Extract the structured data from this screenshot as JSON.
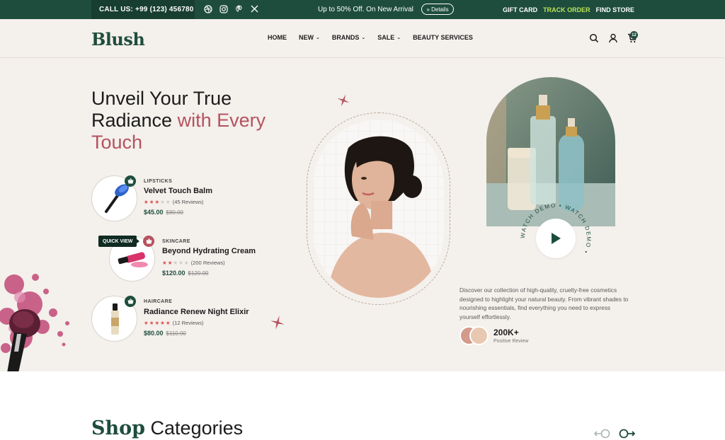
{
  "topbar": {
    "call": "CALL US: +99 (123) 456780",
    "social_icons": [
      "dribbble-icon",
      "instagram-icon",
      "pinterest-icon",
      "x-icon"
    ],
    "promo": "Up to 50% Off. On New Arrival",
    "details_label": "» Details",
    "links": [
      "GIFT CARD",
      "TRACK ORDER",
      "FIND STORE"
    ],
    "highlight_color": "#b9e35a"
  },
  "header": {
    "logo": "Blush",
    "nav": [
      {
        "label": "HOME"
      },
      {
        "label": "NEW"
      },
      {
        "label": "BRANDS"
      },
      {
        "label": "SALE"
      },
      {
        "label": "BEAUTY SERVICES"
      }
    ],
    "cart_count": "12",
    "icons": [
      "search-icon",
      "user-icon",
      "cart-icon"
    ]
  },
  "hero": {
    "headline_1": "Unveil Your True",
    "headline_2a": "Radiance ",
    "headline_2b": "with Every",
    "headline_3": "Touch",
    "quick_view": "QUICK VIEW",
    "products": [
      {
        "category": "LIPSTICKS",
        "name": "Velvet Touch Balm",
        "rating": 3,
        "reviews": "(45 Reviews)",
        "price": "$45.00",
        "old_price": "$80.00"
      },
      {
        "category": "SKINCARE",
        "name": "Beyond Hydrating Cream",
        "rating": 2,
        "reviews": "(200 Reviews)",
        "price": "$120.00",
        "old_price": "$120.00"
      },
      {
        "category": "HAIRCARE",
        "name": "Radiance Renew Night Elixir",
        "rating": 5,
        "reviews": "(12 Reviews)",
        "price": "$80.00",
        "old_price": "$110.00"
      }
    ],
    "watch_demo": "WATCH DEMO  •  WATCH DEMO  •",
    "description": "Discover our collection of high-quality, cruelty-free cosmetics designed to highlight your natural beauty. From vibrant shades to nourishing essentials, find everything you need to express yourself effortlessly.",
    "stat_value": "200K+",
    "stat_label": "Positive Review"
  },
  "shop": {
    "title_bold": "Shop",
    "title_rest": " Categories"
  },
  "colors": {
    "brand_green": "#1e4d3d",
    "accent_rose": "#b5525f",
    "hero_bg": "#f4f0ec"
  }
}
